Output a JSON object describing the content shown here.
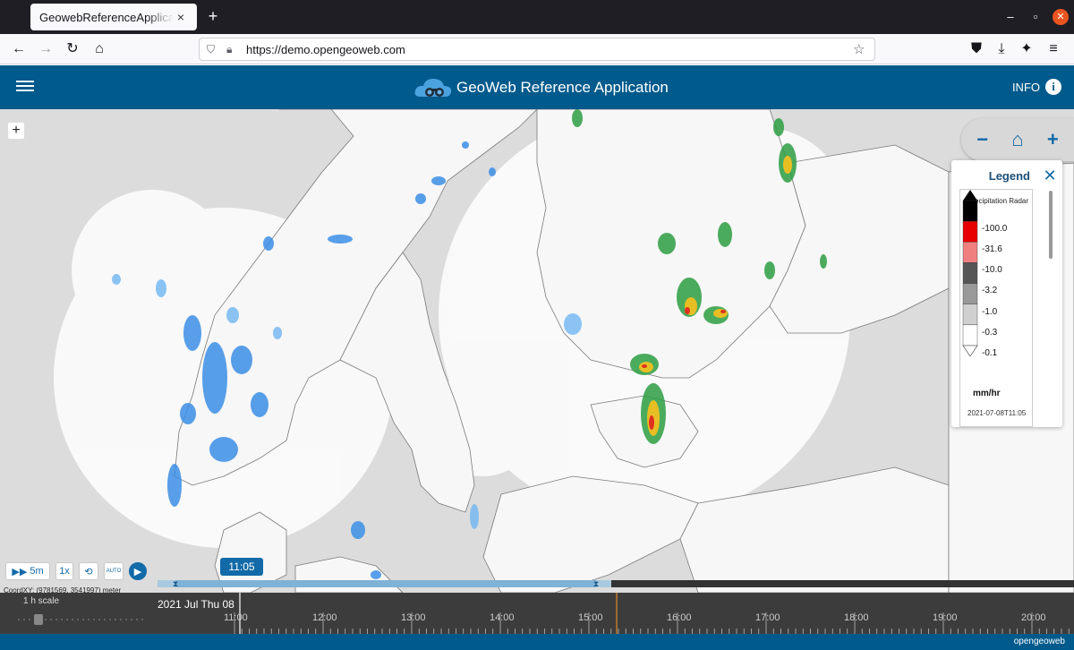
{
  "browser": {
    "tab_title": "GeowebReferenceApplicatio",
    "tab_close": "×",
    "new_tab": "+",
    "url": "https://demo.opengeoweb.com"
  },
  "app": {
    "title": "GeoWeb Reference Application",
    "info_label": "INFO",
    "info_icon_glyph": "i"
  },
  "map": {
    "zoom_out": "−",
    "zoom_in": "+",
    "home_glyph": "⌂",
    "side_plus": "+",
    "land_color": "#f7f7f7",
    "water_color": "#dcdcdc",
    "coverage_color": "#ffffff"
  },
  "legend": {
    "title": "Legend",
    "close_glyph": "✕",
    "layer_name": "Precipitation Radar",
    "levels": [
      "100.0",
      "31.6",
      "10.0",
      "3.2",
      "1.0",
      "0.3",
      "0.1"
    ],
    "level_colors": [
      "#000000",
      "#e60000",
      "#f08080",
      "#555555",
      "#999999",
      "#d0d0d0",
      "#ffffff"
    ],
    "unit": "mm/hr",
    "time": "2021-07-08T11:05"
  },
  "player": {
    "speed_label": "5m",
    "rate_label": "1x",
    "auto_label": "AUTO"
  },
  "coords": "CoordXY: (9781569, 3541997) meter",
  "timeline": {
    "current_time": "11:05",
    "scale_label": "1 h scale",
    "date_label": "2021 Jul Thu 08",
    "hours": [
      "11:00",
      "12:00",
      "13:00",
      "14:00",
      "15:00",
      "16:00",
      "17:00",
      "18:00",
      "19:00",
      "20:00"
    ]
  },
  "footer": {
    "brand": "opengeoweb"
  }
}
